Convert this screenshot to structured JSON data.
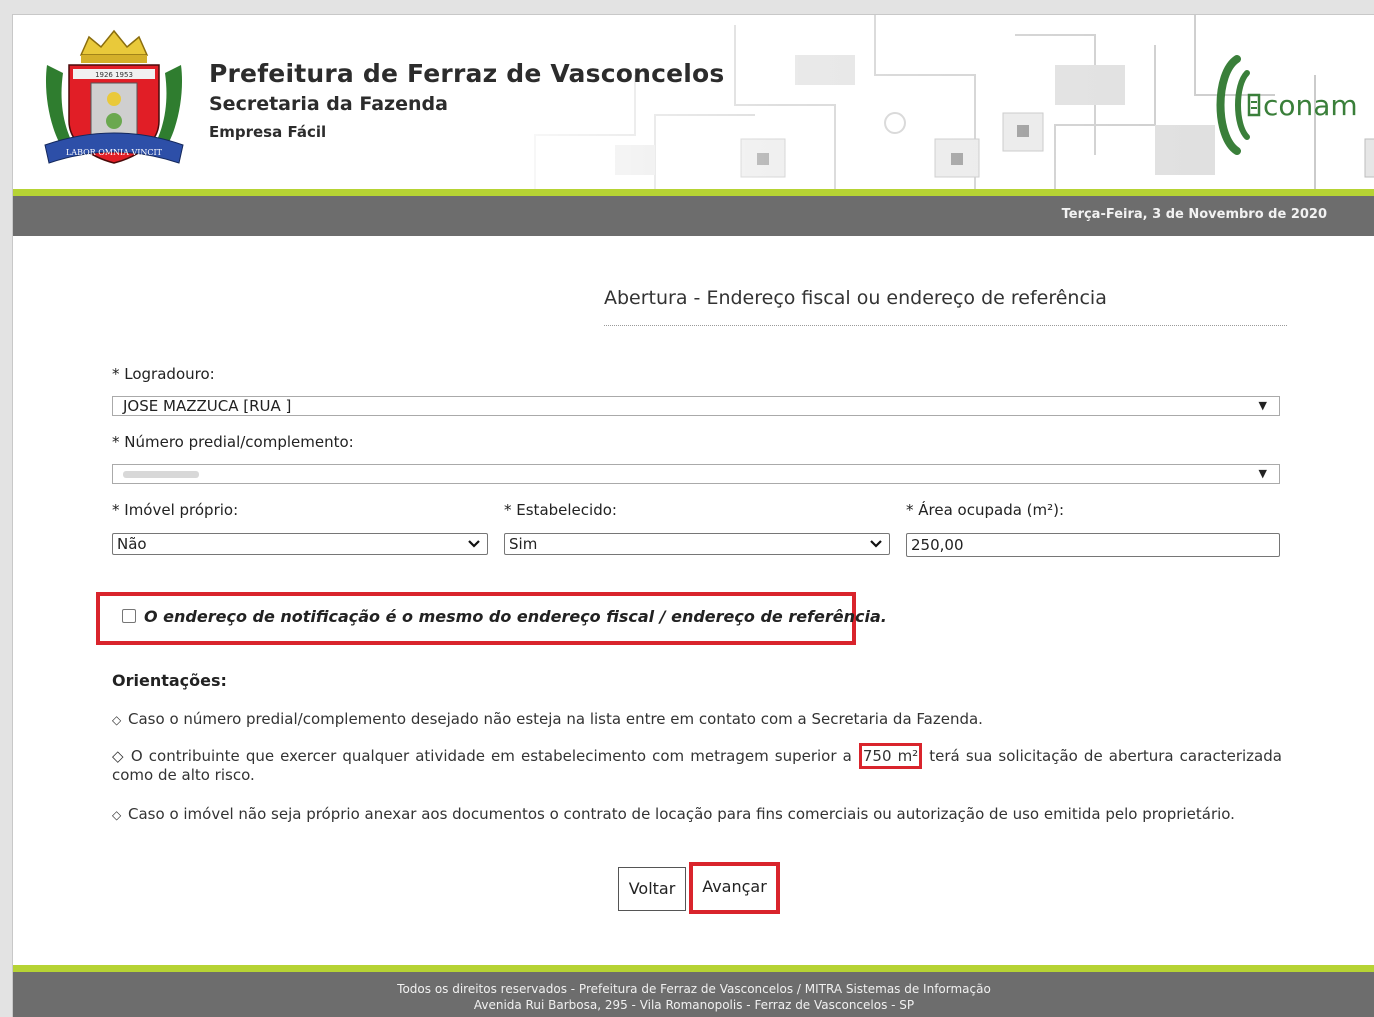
{
  "header": {
    "title": "Prefeitura de Ferraz de Vasconcelos",
    "subtitle": "Secretaria da Fazenda",
    "module": "Empresa Fácil",
    "partner_logo_text": "conam",
    "crest_years": "1926 1953",
    "crest_motto": "LABOR OMNIA VINCIT",
    "date": "Terça-Feira, 3 de Novembro de 2020"
  },
  "form": {
    "title": "Abertura - Endereço fiscal ou endereço de referência",
    "logradouro": {
      "label": "* Logradouro:",
      "value": "JOSE MAZZUCA [RUA ]"
    },
    "numero": {
      "label": "* Número predial/complemento:",
      "value": ""
    },
    "imovel_proprio": {
      "label": "* Imóvel próprio:",
      "value": "Não"
    },
    "estabelecido": {
      "label": "* Estabelecido:",
      "value": "Sim"
    },
    "area": {
      "label": "* Área ocupada (m²):",
      "value": "250,00"
    },
    "notification_checkbox": {
      "label": "O endereço de notificação é o mesmo do endereço fiscal / endereço de referência.",
      "checked": false
    }
  },
  "orientations": {
    "title": "Orientações:",
    "item1": "Caso o número predial/complemento desejado não esteja na lista entre em contato com a Secretaria da Fazenda.",
    "item2_before": "O contribuinte que exercer qualquer atividade em estabelecimento com metragem superior a",
    "item2_highlight": "750 m²",
    "item2_after": "terá sua solicitação de abertura caracterizada como de alto risco.",
    "item3": "Caso o imóvel não seja próprio anexar aos documentos o contrato de locação para fins comerciais ou autorização de uso emitida pelo proprietário.",
    "bullet": "◇"
  },
  "buttons": {
    "back": "Voltar",
    "next": "Avançar"
  },
  "footer": {
    "line1": "Todos os direitos reservados - Prefeitura de Ferraz de Vasconcelos / MITRA Sistemas de Informação",
    "line2": "Avenida Rui Barbosa, 295 - Vila Romanopolis - Ferraz de Vasconcelos - SP"
  },
  "colors": {
    "accent_green": "#b6d334",
    "bar_gray": "#6d6d6d",
    "highlight_red": "#d9242c"
  }
}
